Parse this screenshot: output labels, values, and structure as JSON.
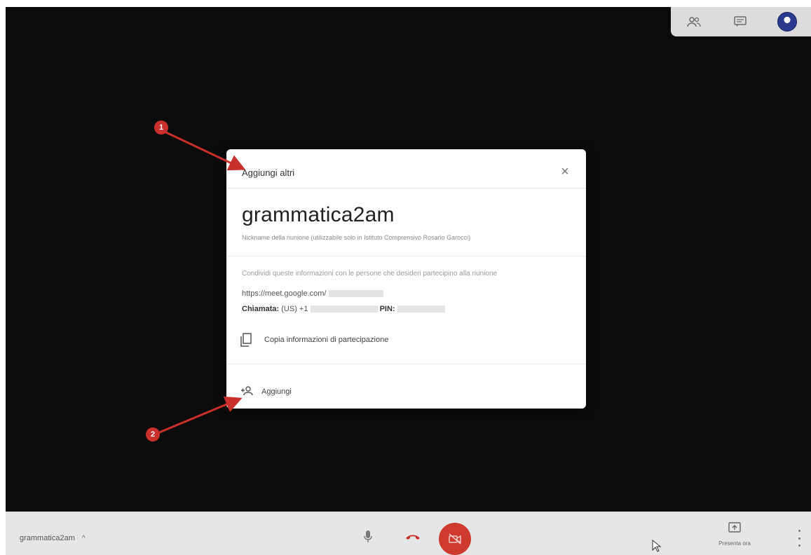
{
  "dialog": {
    "title": "Aggiungi altri",
    "close_label": "×",
    "meeting_name": "grammatica2am",
    "subtitle": "Nickname della riunione (utilizzabile solo in Istituto Comprensivo Rosario Garocci)",
    "share_text": "Condividi queste informazioni con le persone che desideri partecipino alla riunione",
    "link": "https://meet.google.com/",
    "call_label": "Chiamata:",
    "call_value": "(US) +1",
    "pin_label": "PIN:",
    "copy_label": "Copia informazioni di partecipazione",
    "add_label": "Aggiungi"
  },
  "annotations": {
    "marker1": "1",
    "marker2": "2"
  },
  "bottom_bar": {
    "meeting_name": "grammatica2am",
    "chevron": "^",
    "present_label": "Presenta ora"
  },
  "icons": {
    "top": [
      "people-icon",
      "chat-icon",
      "avatar"
    ],
    "dialog": [
      "close-icon",
      "copy-icon",
      "add-person-icon"
    ],
    "bottom": [
      "mic-icon",
      "hangup-icon",
      "camera-off-icon",
      "present-icon",
      "more-icon"
    ]
  },
  "colors": {
    "stage": "#0b0b0b",
    "annotation": "#c9302c",
    "camera_button": "#cf3a2e"
  }
}
